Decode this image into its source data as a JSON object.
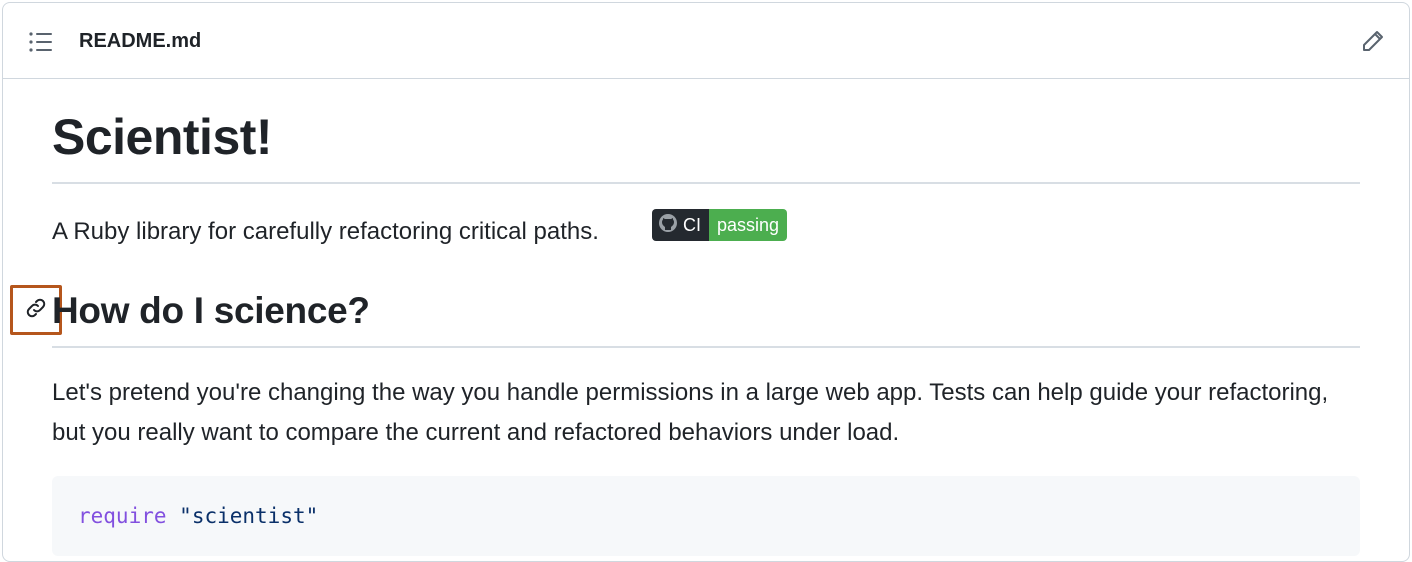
{
  "header": {
    "filename": "README.md",
    "icons": {
      "outline": "list-icon",
      "edit": "pencil-icon"
    }
  },
  "readme": {
    "title": "Scientist!",
    "intro": "A Ruby library for carefully refactoring critical paths.",
    "badge": {
      "label": "CI",
      "status": "passing",
      "label_color": "#24292f",
      "status_color": "#4cae4f"
    },
    "section_heading": "How do I science?",
    "section_body": "Let's pretend you're changing the way you handle permissions in a large web app. Tests can help guide your refactoring, but you really want to compare the current and refactored behaviors under load.",
    "code": {
      "keyword": "require",
      "string": "\"scientist\""
    }
  },
  "highlight_color": "#b5561c"
}
